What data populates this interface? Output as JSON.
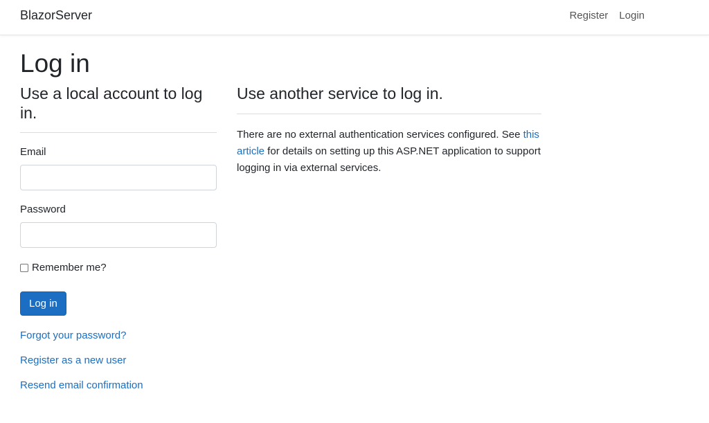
{
  "navbar": {
    "brand": "BlazorServer",
    "links": [
      {
        "label": "Register"
      },
      {
        "label": "Login"
      }
    ]
  },
  "page": {
    "title": "Log in"
  },
  "local_account": {
    "heading": "Use a local account to log in.",
    "email_label": "Email",
    "email_value": "",
    "password_label": "Password",
    "password_value": "",
    "remember_label": "Remember me?",
    "remember_checked": false,
    "submit_label": "Log in",
    "links": {
      "forgot": "Forgot your password?",
      "register": "Register as a new user",
      "resend": "Resend email confirmation"
    }
  },
  "external": {
    "heading": "Use another service to log in.",
    "text_before": "There are no external authentication services configured. See ",
    "link_text": "this article",
    "text_after": " for details on setting up this ASP.NET application to support logging in via external services."
  },
  "colors": {
    "primary": "#1b6ec2",
    "link": "#1b6ec2"
  }
}
